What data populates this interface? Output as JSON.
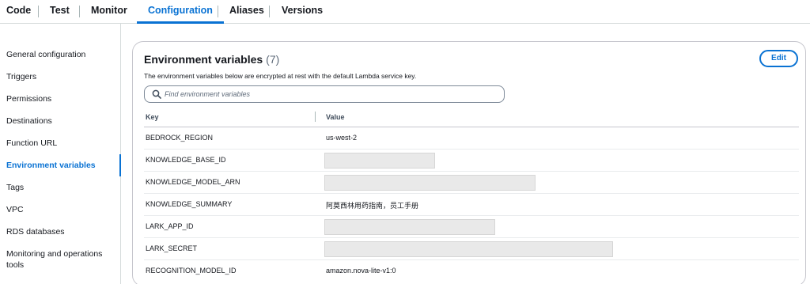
{
  "tabs": [
    "Code",
    "Test",
    "Monitor",
    "Configuration",
    "Aliases",
    "Versions"
  ],
  "active_tab": "Configuration",
  "sidebar": {
    "items": [
      "General configuration",
      "Triggers",
      "Permissions",
      "Destinations",
      "Function URL",
      "Environment variables",
      "Tags",
      "VPC",
      "RDS databases",
      "Monitoring and operations tools"
    ],
    "active": "Environment variables"
  },
  "panel": {
    "title": "Environment variables",
    "count": "(7)",
    "description": "The environment variables below are encrypted at rest with the default Lambda service key.",
    "edit_label": "Edit",
    "search_placeholder": "Find environment variables",
    "search_value": "",
    "columns": {
      "key": "Key",
      "value": "Value"
    },
    "rows": [
      {
        "key": "BEDROCK_REGION",
        "value": "us-west-2",
        "redacted": false
      },
      {
        "key": "KNOWLEDGE_BASE_ID",
        "value": "",
        "redacted": true
      },
      {
        "key": "KNOWLEDGE_MODEL_ARN",
        "value": "",
        "redacted": true
      },
      {
        "key": "KNOWLEDGE_SUMMARY",
        "value": "阿莫西林用药指南，员工手册",
        "redacted": false
      },
      {
        "key": "LARK_APP_ID",
        "value": "",
        "redacted": true
      },
      {
        "key": "LARK_SECRET",
        "value": "",
        "redacted": true
      },
      {
        "key": "RECOGNITION_MODEL_ID",
        "value": "amazon.nova-lite-v1:0",
        "redacted": false
      }
    ]
  },
  "colors": {
    "accent": "#0972d3",
    "text": "#16191f",
    "redaction": "#e9e9e9"
  },
  "icons": {
    "search": "search-icon"
  }
}
